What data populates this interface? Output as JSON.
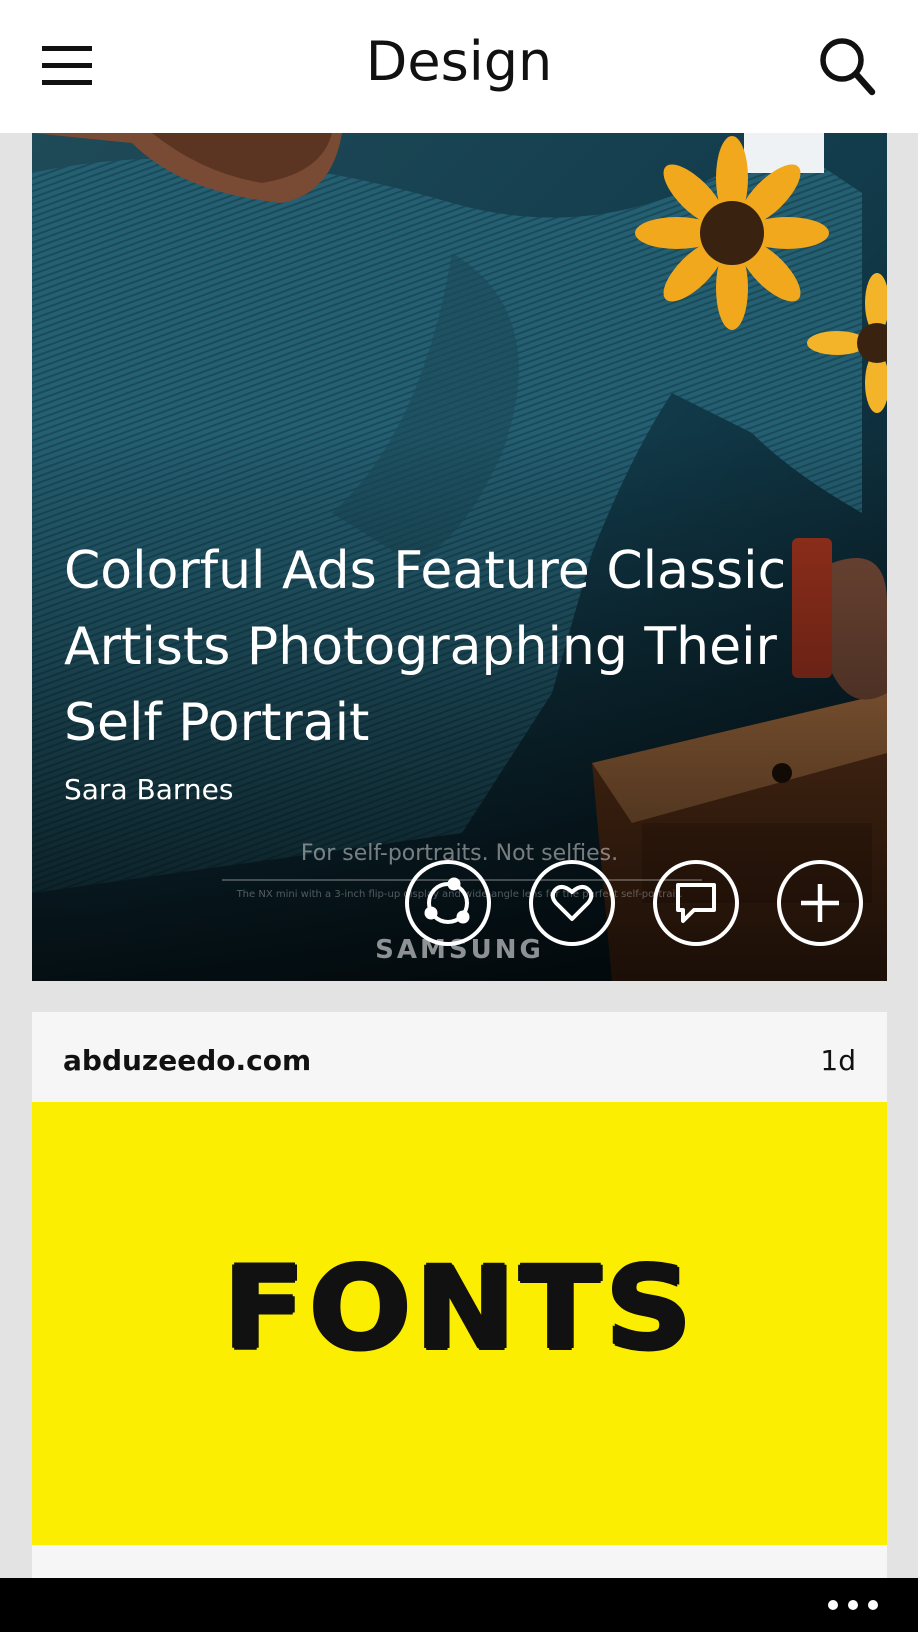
{
  "header": {
    "title": "Design"
  },
  "hero": {
    "title": "Colorful Ads Feature Classic Artists Photographing Their Self Portrait",
    "author": "Sara Barnes",
    "ad_tagline": "For self-portraits. Not selfies.",
    "ad_subline": "The NX mini with a 3-inch flip-up display and wide-angle lens for the perfect self-portrait.",
    "ad_brand": "SAMSUNG"
  },
  "source_card": {
    "source": "abduzeedo.com",
    "age": "1d",
    "image_text": "FONTS"
  },
  "colors": {
    "header_bg": "#ffffff",
    "feed_bg": "#e3e3e3",
    "hero_bg": "#123845",
    "fonts_bg": "#fbee00",
    "appbar_bg": "#000000"
  }
}
